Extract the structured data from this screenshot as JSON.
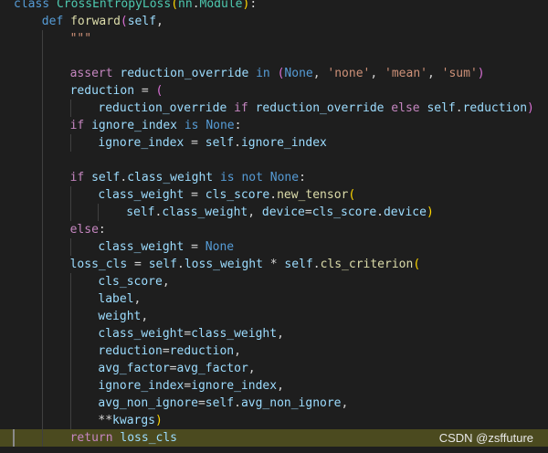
{
  "code_lines": [
    {
      "indent": 0,
      "tokens": [
        {
          "text": "class ",
          "c": "k"
        },
        {
          "text": "CrossEntropyLoss",
          "c": "t"
        },
        {
          "text": "(",
          "c": "p1"
        },
        {
          "text": "nn",
          "c": "t"
        },
        {
          "text": ".",
          "c": ""
        },
        {
          "text": "Module",
          "c": "t"
        },
        {
          "text": ")",
          "c": "p1"
        },
        {
          "text": ":",
          "c": ""
        }
      ]
    },
    {
      "indent": 4,
      "tokens": [
        {
          "text": "def ",
          "c": "k"
        },
        {
          "text": "forward",
          "c": "f"
        },
        {
          "text": "(",
          "c": "p2"
        },
        {
          "text": "self",
          "c": "v"
        },
        {
          "text": ",",
          "c": ""
        }
      ]
    },
    {
      "indent": 8,
      "tokens": [
        {
          "text": "\"\"\"",
          "c": "s"
        }
      ]
    },
    {
      "indent": 8,
      "tokens": []
    },
    {
      "indent": 8,
      "tokens": [
        {
          "text": "assert ",
          "c": "kc"
        },
        {
          "text": "reduction_override",
          "c": "v"
        },
        {
          "text": " in ",
          "c": "k"
        },
        {
          "text": "(",
          "c": "p2"
        },
        {
          "text": "None",
          "c": "k"
        },
        {
          "text": ", ",
          "c": ""
        },
        {
          "text": "'none'",
          "c": "s"
        },
        {
          "text": ", ",
          "c": ""
        },
        {
          "text": "'mean'",
          "c": "s"
        },
        {
          "text": ", ",
          "c": ""
        },
        {
          "text": "'sum'",
          "c": "s"
        },
        {
          "text": ")",
          "c": "p2"
        }
      ]
    },
    {
      "indent": 8,
      "tokens": [
        {
          "text": "reduction",
          "c": "v"
        },
        {
          "text": " = ",
          "c": ""
        },
        {
          "text": "(",
          "c": "p2"
        }
      ]
    },
    {
      "indent": 12,
      "tokens": [
        {
          "text": "reduction_override",
          "c": "v"
        },
        {
          "text": " if ",
          "c": "kc"
        },
        {
          "text": "reduction_override",
          "c": "v"
        },
        {
          "text": " else ",
          "c": "kc"
        },
        {
          "text": "self",
          "c": "v"
        },
        {
          "text": ".",
          "c": ""
        },
        {
          "text": "reduction",
          "c": "v"
        },
        {
          "text": ")",
          "c": "p2"
        }
      ]
    },
    {
      "indent": 8,
      "tokens": [
        {
          "text": "if ",
          "c": "kc"
        },
        {
          "text": "ignore_index",
          "c": "v"
        },
        {
          "text": " is ",
          "c": "k"
        },
        {
          "text": "None",
          "c": "k"
        },
        {
          "text": ":",
          "c": ""
        }
      ]
    },
    {
      "indent": 12,
      "tokens": [
        {
          "text": "ignore_index",
          "c": "v"
        },
        {
          "text": " = ",
          "c": ""
        },
        {
          "text": "self",
          "c": "v"
        },
        {
          "text": ".",
          "c": ""
        },
        {
          "text": "ignore_index",
          "c": "v"
        }
      ]
    },
    {
      "indent": 8,
      "tokens": []
    },
    {
      "indent": 8,
      "tokens": [
        {
          "text": "if ",
          "c": "kc"
        },
        {
          "text": "self",
          "c": "v"
        },
        {
          "text": ".",
          "c": ""
        },
        {
          "text": "class_weight",
          "c": "v"
        },
        {
          "text": " is not ",
          "c": "k"
        },
        {
          "text": "None",
          "c": "k"
        },
        {
          "text": ":",
          "c": ""
        }
      ]
    },
    {
      "indent": 12,
      "tokens": [
        {
          "text": "class_weight",
          "c": "v"
        },
        {
          "text": " = ",
          "c": ""
        },
        {
          "text": "cls_score",
          "c": "v"
        },
        {
          "text": ".",
          "c": ""
        },
        {
          "text": "new_tensor",
          "c": "f"
        },
        {
          "text": "(",
          "c": "p1"
        }
      ]
    },
    {
      "indent": 16,
      "tokens": [
        {
          "text": "self",
          "c": "v"
        },
        {
          "text": ".",
          "c": ""
        },
        {
          "text": "class_weight",
          "c": "v"
        },
        {
          "text": ", ",
          "c": ""
        },
        {
          "text": "device",
          "c": "v"
        },
        {
          "text": "=",
          "c": ""
        },
        {
          "text": "cls_score",
          "c": "v"
        },
        {
          "text": ".",
          "c": ""
        },
        {
          "text": "device",
          "c": "v"
        },
        {
          "text": ")",
          "c": "p1"
        }
      ]
    },
    {
      "indent": 8,
      "tokens": [
        {
          "text": "else",
          "c": "kc"
        },
        {
          "text": ":",
          "c": ""
        }
      ]
    },
    {
      "indent": 12,
      "tokens": [
        {
          "text": "class_weight",
          "c": "v"
        },
        {
          "text": " = ",
          "c": ""
        },
        {
          "text": "None",
          "c": "k"
        }
      ]
    },
    {
      "indent": 8,
      "tokens": [
        {
          "text": "loss_cls",
          "c": "v"
        },
        {
          "text": " = ",
          "c": ""
        },
        {
          "text": "self",
          "c": "v"
        },
        {
          "text": ".",
          "c": ""
        },
        {
          "text": "loss_weight",
          "c": "v"
        },
        {
          "text": " * ",
          "c": ""
        },
        {
          "text": "self",
          "c": "v"
        },
        {
          "text": ".",
          "c": ""
        },
        {
          "text": "cls_criterion",
          "c": "f"
        },
        {
          "text": "(",
          "c": "p1"
        }
      ]
    },
    {
      "indent": 12,
      "tokens": [
        {
          "text": "cls_score",
          "c": "v"
        },
        {
          "text": ",",
          "c": ""
        }
      ]
    },
    {
      "indent": 12,
      "tokens": [
        {
          "text": "label",
          "c": "v"
        },
        {
          "text": ",",
          "c": ""
        }
      ]
    },
    {
      "indent": 12,
      "tokens": [
        {
          "text": "weight",
          "c": "v"
        },
        {
          "text": ",",
          "c": ""
        }
      ]
    },
    {
      "indent": 12,
      "tokens": [
        {
          "text": "class_weight",
          "c": "v"
        },
        {
          "text": "=",
          "c": ""
        },
        {
          "text": "class_weight",
          "c": "v"
        },
        {
          "text": ",",
          "c": ""
        }
      ]
    },
    {
      "indent": 12,
      "tokens": [
        {
          "text": "reduction",
          "c": "v"
        },
        {
          "text": "=",
          "c": ""
        },
        {
          "text": "reduction",
          "c": "v"
        },
        {
          "text": ",",
          "c": ""
        }
      ]
    },
    {
      "indent": 12,
      "tokens": [
        {
          "text": "avg_factor",
          "c": "v"
        },
        {
          "text": "=",
          "c": ""
        },
        {
          "text": "avg_factor",
          "c": "v"
        },
        {
          "text": ",",
          "c": ""
        }
      ]
    },
    {
      "indent": 12,
      "tokens": [
        {
          "text": "ignore_index",
          "c": "v"
        },
        {
          "text": "=",
          "c": ""
        },
        {
          "text": "ignore_index",
          "c": "v"
        },
        {
          "text": ",",
          "c": ""
        }
      ]
    },
    {
      "indent": 12,
      "tokens": [
        {
          "text": "avg_non_ignore",
          "c": "v"
        },
        {
          "text": "=",
          "c": ""
        },
        {
          "text": "self",
          "c": "v"
        },
        {
          "text": ".",
          "c": ""
        },
        {
          "text": "avg_non_ignore",
          "c": "v"
        },
        {
          "text": ",",
          "c": ""
        }
      ]
    },
    {
      "indent": 12,
      "tokens": [
        {
          "text": "**",
          "c": ""
        },
        {
          "text": "kwargs",
          "c": "v"
        },
        {
          "text": ")",
          "c": "p1"
        }
      ]
    },
    {
      "indent": 8,
      "current": true,
      "tokens": [
        {
          "text": "return ",
          "c": "kc"
        },
        {
          "text": "loss_cls",
          "c": "v"
        }
      ]
    }
  ],
  "watermark": "CSDN @zsffuture"
}
